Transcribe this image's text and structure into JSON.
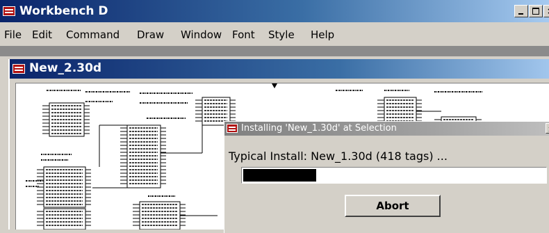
{
  "app": {
    "title": "Workbench D"
  },
  "menu": [
    "File",
    "Edit",
    "Command",
    "Draw",
    "Window",
    "Font",
    "Style",
    "Help"
  ],
  "document": {
    "title": "New_2.30d"
  },
  "dialog": {
    "title": "Installing 'New_1.30d' at Selection",
    "message": "Typical Install: New_1.30d (418 tags) ...",
    "progress_fraction": 0.24,
    "abort_label": "Abort"
  },
  "colors": {
    "title_active": "#0a246a",
    "title_inactive": "#808080",
    "face": "#d4d0c8",
    "progress": "#000000"
  },
  "icons": {
    "app": "app-logo-icon",
    "document": "app-logo-icon",
    "dialog": "app-logo-icon",
    "minimize": "minimize-icon",
    "maximize": "maximize-icon",
    "close": "close-icon"
  }
}
